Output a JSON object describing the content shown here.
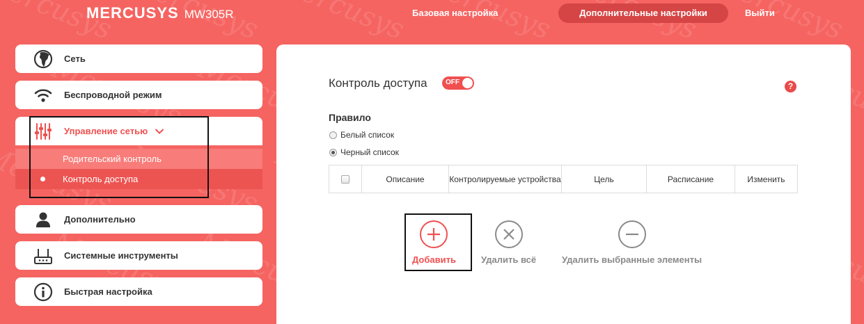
{
  "brand": {
    "name": "MERCUSYS",
    "model": "MW305R",
    "watermark": "Mercusys"
  },
  "top_nav": {
    "basic": "Базовая настройка",
    "advanced": "Дополнительные настройки",
    "logout": "Выйти"
  },
  "sidebar": {
    "items": [
      {
        "label": "Сеть",
        "icon": "globe-icon"
      },
      {
        "label": "Беспроводной режим",
        "icon": "wifi-icon"
      },
      {
        "label": "Управление сетью",
        "icon": "sliders-icon",
        "expanded": true
      },
      {
        "label": "Дополнительно",
        "icon": "user-icon"
      },
      {
        "label": "Системные инструменты",
        "icon": "router-icon"
      },
      {
        "label": "Быстрая настройка",
        "icon": "info-icon"
      }
    ],
    "sub_items": [
      {
        "label": "Родительский контроль"
      },
      {
        "label": "Контроль доступа",
        "selected": true
      }
    ]
  },
  "main": {
    "title": "Контроль доступа",
    "toggle_label": "OFF",
    "help": "?",
    "rule_label": "Правило",
    "radio_options": [
      {
        "label": "Белый список",
        "checked": false
      },
      {
        "label": "Черный список",
        "checked": true
      }
    ],
    "table_headers": [
      "Описание",
      "Контролируемые устройства",
      "Цель",
      "Расписание",
      "Изменить"
    ],
    "actions": {
      "add": "Добавить",
      "delete_all": "Удалить всё",
      "delete_selected": "Удалить выбранные элементы"
    }
  },
  "colors": {
    "background": "#f56461",
    "accent": "#f05050",
    "active_tab": "#d64545",
    "disabled": "#8a8a8a"
  }
}
